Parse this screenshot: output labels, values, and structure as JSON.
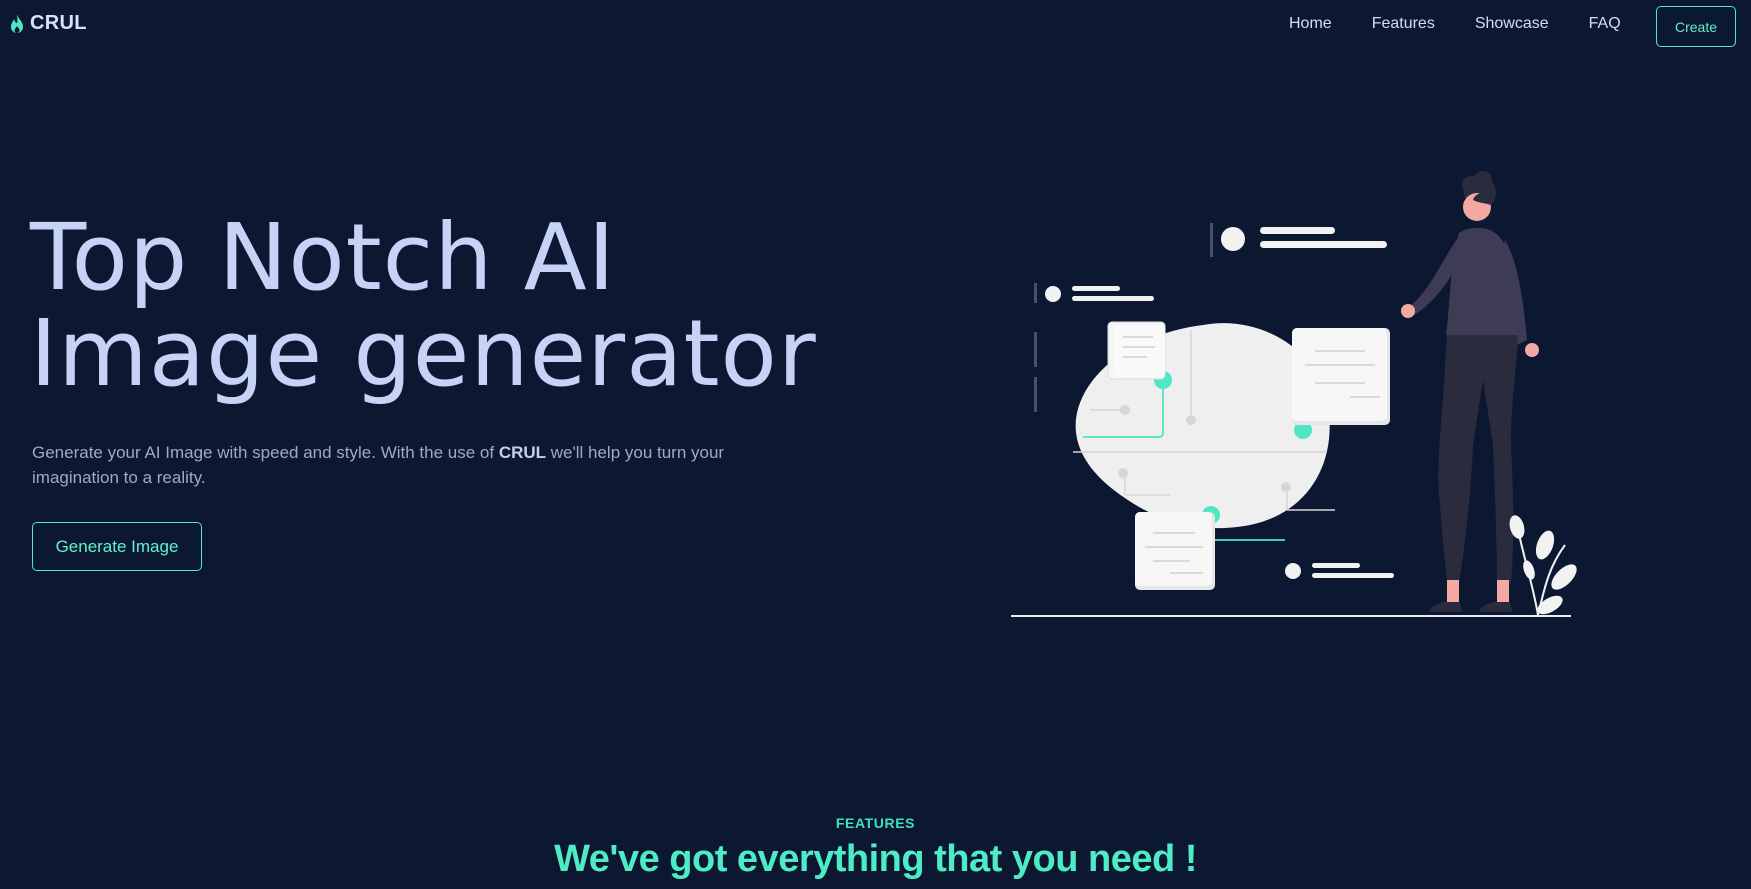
{
  "nav": {
    "brand": "CRUL",
    "links": [
      "Home",
      "Features",
      "Showcase",
      "FAQ"
    ],
    "create_label": "Create"
  },
  "hero": {
    "title_line1": "Top Notch AI",
    "title_line2": "Image generator",
    "desc_part1": "Generate your AI Image with speed and style. With the use of ",
    "desc_brand": "CRUL",
    "desc_part2": " we'll help you turn your imagination to a reality.",
    "cta_label": "Generate Image"
  },
  "features": {
    "label": "FEATURES",
    "title": "We've got everything that you need !"
  },
  "colors": {
    "background": "#0c1831",
    "accent": "#4ee6c4",
    "heading": "#c6d3f7"
  },
  "icons": [
    "flame-icon"
  ]
}
